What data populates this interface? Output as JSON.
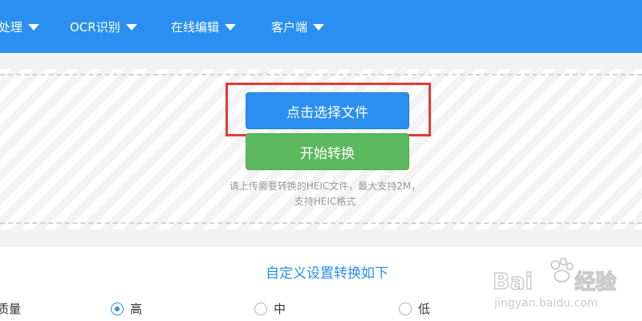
{
  "nav": {
    "items": [
      {
        "label": "处理"
      },
      {
        "label": "OCR识别"
      },
      {
        "label": "在线编辑"
      },
      {
        "label": "客户端"
      }
    ]
  },
  "upload": {
    "select_label": "点击选择文件",
    "start_label": "开始转换",
    "hint_line1": "请上传需要转换的HEIC文件，最大支持2M，",
    "hint_line2": "支持HEIC格式"
  },
  "settings": {
    "title": "自定义设置转换如下",
    "quality_label": "质量",
    "options": [
      {
        "label": "高",
        "checked": true
      },
      {
        "label": "中",
        "checked": false
      },
      {
        "label": "低",
        "checked": false
      }
    ]
  },
  "watermark": {
    "brand": "Baidu经验",
    "url": "jingyan.baidu.com"
  },
  "colors": {
    "nav_bg": "#2a8ff0",
    "select_btn": "#2b8ff1",
    "start_btn": "#5cb85c",
    "highlight": "#e53935"
  }
}
